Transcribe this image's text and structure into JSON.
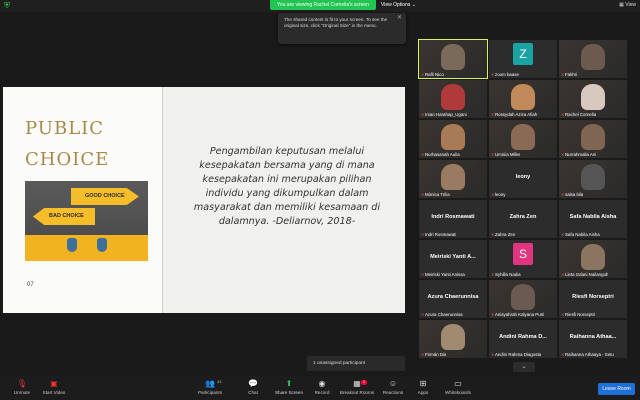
{
  "topbar": {
    "banner": "You are viewing Rachel Cornelia's screen",
    "view_options": "View Options ⌄",
    "view": "View"
  },
  "toast": {
    "text": "The shared content is fit to your screen. To see the original size, click \"Original Size\" in the menu."
  },
  "slide": {
    "title_line1": "PUBLIC",
    "title_line2": "CHOICE",
    "sign_good": "GOOD CHOICE",
    "sign_bad": "BAD CHOICE",
    "number": "07",
    "quote": "Pengambilan keputusan melalui kesepakatan bersama yang di mana kesepakatan ini merupakan pilihan individu yang dikumpulkan dalam masyarakat dan memiliki kesamaan di dalamnya. -Deliarnov, 2018-"
  },
  "participants": [
    {
      "name": "Rafli Nico",
      "type": "video",
      "color": "#7a6a5a",
      "active": true
    },
    {
      "name": "zoom baase",
      "type": "letter",
      "letter": "Z",
      "color": "#1aa3a3"
    },
    {
      "name": "Fakhri",
      "type": "video",
      "color": "#6b5a4d"
    },
    {
      "name": "Irsan Harahap_Ugani",
      "type": "video",
      "color": "#b03a3a"
    },
    {
      "name": "Rossydah Aziza Afiah",
      "type": "video",
      "color": "#c08a5a"
    },
    {
      "name": "Rachel Cornelia",
      "type": "video",
      "color": "#d9c8c0"
    },
    {
      "name": "Nurhasanah Aulia",
      "type": "video",
      "color": "#a87a55"
    },
    {
      "name": "Umniia Miller",
      "type": "video",
      "color": "#8a6a55"
    },
    {
      "name": "Nurrahmalia Ani",
      "type": "video",
      "color": "#7f6552"
    },
    {
      "name": "Mònica Trilia",
      "type": "video",
      "color": "#9a7a60"
    },
    {
      "name": "leony",
      "type": "name",
      "label": "leony"
    },
    {
      "name": "salsa bila",
      "type": "video",
      "color": "#555"
    },
    {
      "name": "Indri Rosmawati",
      "type": "name",
      "label": "Indri Rosmawati"
    },
    {
      "name": "Zahra Zen",
      "type": "name",
      "label": "Zahra Zen"
    },
    {
      "name": "Safa Nabila Aisha",
      "type": "name",
      "label": "Safa Nabila Aisha"
    },
    {
      "name": "Meiriski Yanti Anissa",
      "type": "name",
      "label": "Meiriski Yanti A..."
    },
    {
      "name": "Syhilla Nadia",
      "type": "letter",
      "letter": "S",
      "color": "#e2357f"
    },
    {
      "name": "Lieta Izdani Nailangoh",
      "type": "video",
      "color": "#8a7560"
    },
    {
      "name": "Azura Chaerunnisa",
      "type": "name",
      "label": "Azura Chaerunnisa"
    },
    {
      "name": "Anisyahrah Kalyana Putri",
      "type": "video",
      "color": "#6a5a50"
    },
    {
      "name": "Riesfi Norseptri",
      "type": "name",
      "label": "Riesfi Norseptri"
    },
    {
      "name": "Firmán Dia",
      "type": "video",
      "color": "#a08a70"
    },
    {
      "name": "Andini Rahma Diagosta",
      "type": "name",
      "label": "Andini Rahma D..."
    },
    {
      "name": "Raihanna Athaaya - Setu",
      "type": "name",
      "label": "Raihanna Athaa..."
    }
  ],
  "unassigned": "1 unassigned participant",
  "toolbar": {
    "unmute": "Unmute",
    "start_video": "Start Video",
    "participants": "Participants",
    "participants_count": "43",
    "chat": "Chat",
    "share_screen": "Share Screen",
    "record": "Record",
    "breakout_rooms": "Breakout Rooms",
    "breakout_badge": "1",
    "reactions": "Reactions",
    "apps": "Apps",
    "whiteboards": "Whiteboards",
    "leave": "Leave Room"
  }
}
